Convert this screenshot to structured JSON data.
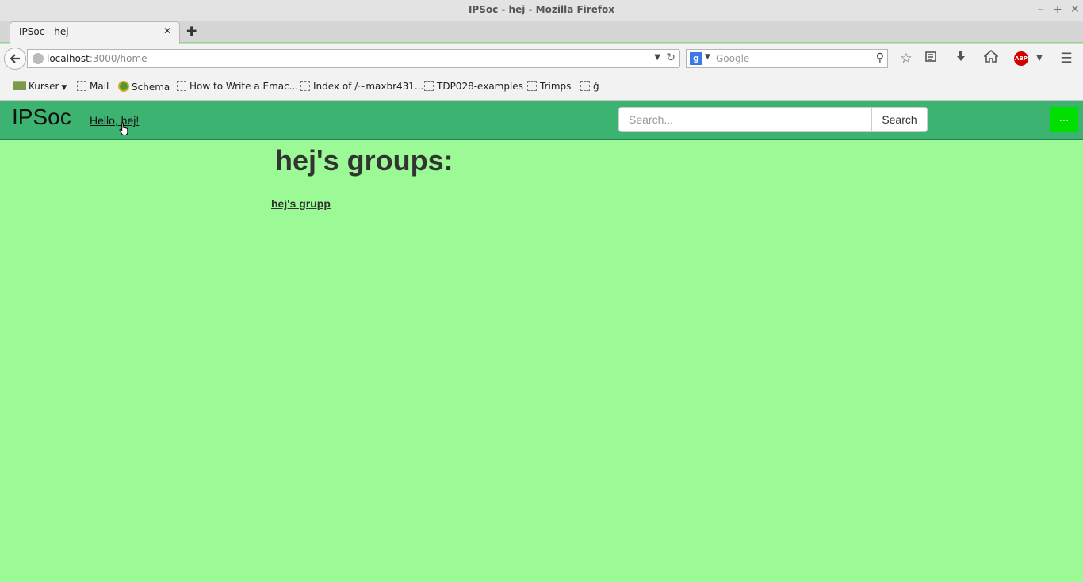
{
  "window": {
    "title": "IPSoc - hej - Mozilla Firefox",
    "controls": [
      "–",
      "+",
      "✕"
    ]
  },
  "tabs": [
    {
      "label": "IPSoc - hej",
      "close": "✕"
    }
  ],
  "new_tab": "✚",
  "navbar": {
    "url_host": "localhost",
    "url_path": ":3000/home",
    "search_placeholder": "Google",
    "search_engine_icon": "g",
    "abp_label": "ABP"
  },
  "bookmarks": [
    {
      "label": "Kurser",
      "icon": "folder-icon"
    },
    {
      "label": "Mail",
      "icon": "page-icon"
    },
    {
      "label": "Schema",
      "icon": "globe-icon"
    },
    {
      "label": "How to Write a Emac...",
      "icon": "page-icon"
    },
    {
      "label": "Index of /~maxbr431...",
      "icon": "page-icon"
    },
    {
      "label": "TDP028-examples",
      "icon": "page-icon"
    },
    {
      "label": "Trimps",
      "icon": "page-icon"
    },
    {
      "label": "ģ",
      "icon": "page-icon"
    }
  ],
  "site": {
    "brand": "IPSoc",
    "greeting": "Hello, hej!",
    "search_placeholder": "Search...",
    "search_button": "Search",
    "more_button": "...",
    "header_color": "#3cb371",
    "page_background": "#9bfa95"
  },
  "main": {
    "heading": "hej's groups:",
    "groups": [
      "hej's grupp"
    ]
  }
}
